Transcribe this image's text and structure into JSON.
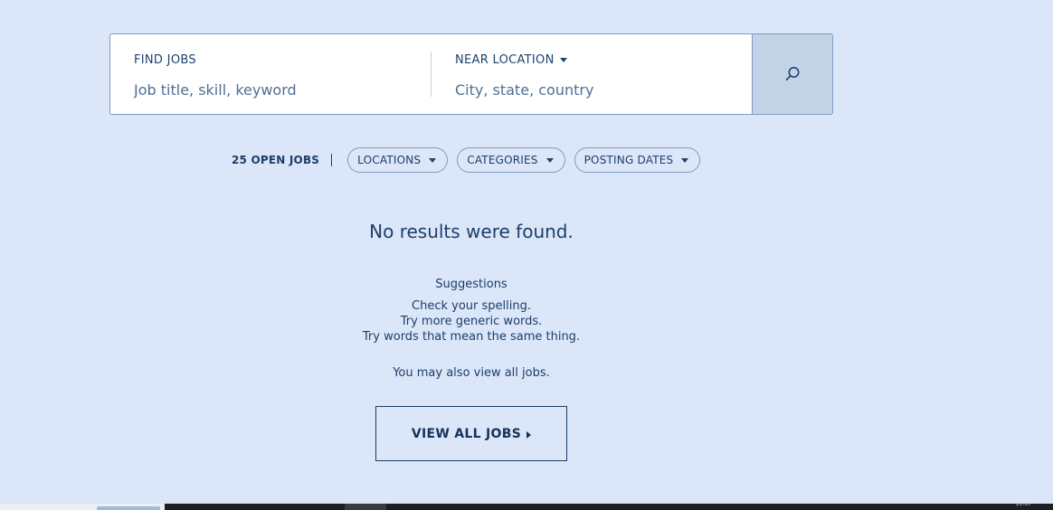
{
  "search": {
    "keyword_label": "FIND JOBS",
    "keyword_placeholder": "Job title, skill, keyword",
    "keyword_value": "",
    "location_label": "NEAR LOCATION",
    "location_placeholder": "City, state, country",
    "location_value": "",
    "button_icon": "search-icon"
  },
  "filters": {
    "open_jobs": "25 OPEN JOBS",
    "separator": "|",
    "pills": [
      {
        "label": "LOCATIONS"
      },
      {
        "label": "CATEGORIES"
      },
      {
        "label": "POSTING DATES"
      }
    ]
  },
  "results": {
    "no_results": "No results were found.",
    "suggestions_title": "Suggestions",
    "suggestions": [
      "Check your spelling.",
      "Try more generic words.",
      "Try words that mean the same thing."
    ],
    "view_all_text": "You may also view all jobs.",
    "view_all_button": "VIEW ALL JOBS"
  },
  "taskbar": {
    "clock": "10:07"
  },
  "colors": {
    "page_background": "#dbe6f8",
    "text": "#1c3e6a",
    "search_button_background": "#c4d2e6",
    "border": "#7f9bc2"
  }
}
